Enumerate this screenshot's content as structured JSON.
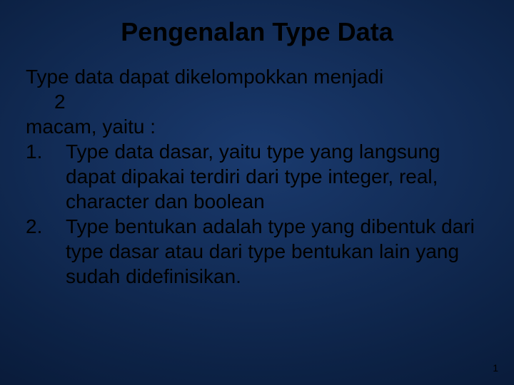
{
  "slide": {
    "title": "Pengenalan Type Data",
    "intro_line1": "Type data dapat dikelompokkan menjadi",
    "intro_num": "2",
    "intro_line2": "macam, yaitu :",
    "items": [
      "Type data dasar, yaitu type yang langsung dapat dipakai terdiri dari type integer, real, character dan boolean",
      "Type bentukan adalah type yang dibentuk dari type dasar atau dari type bentukan lain yang sudah didefinisikan."
    ],
    "page_number": "1"
  }
}
